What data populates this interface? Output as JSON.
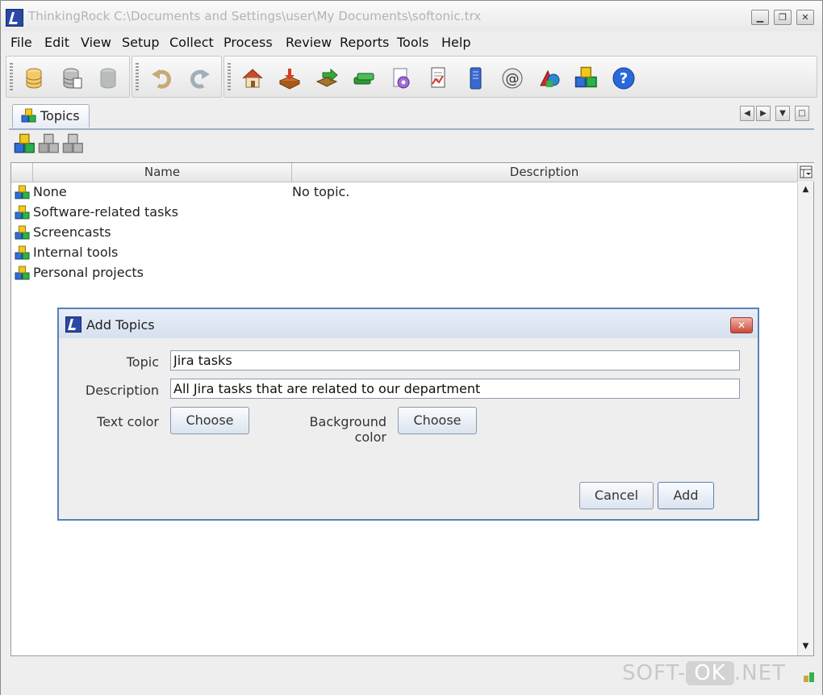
{
  "window": {
    "title": "ThinkingRock C:\\Documents and Settings\\user\\My Documents\\softonic.trx",
    "controls": [
      "minimize-icon",
      "restore-icon",
      "close-icon"
    ]
  },
  "menu": [
    "File",
    "Edit",
    "View",
    "Setup",
    "Collect",
    "Process",
    "Review",
    "Reports",
    "Tools",
    "Help"
  ],
  "tab": {
    "label": "Topics"
  },
  "table": {
    "columns": [
      "Name",
      "Description"
    ],
    "rows": [
      {
        "name": "None",
        "description": "No topic."
      },
      {
        "name": "Software-related tasks",
        "description": ""
      },
      {
        "name": "Screencasts",
        "description": ""
      },
      {
        "name": "Internal tools",
        "description": ""
      },
      {
        "name": "Personal projects",
        "description": ""
      }
    ]
  },
  "dialog": {
    "title": "Add Topics",
    "topic_label": "Topic",
    "topic_value": "Jira tasks",
    "description_label": "Description",
    "description_value": "All Jira tasks that are related to our department",
    "text_color_label": "Text color",
    "text_color_button": "Choose",
    "background_color_label": "Background color",
    "background_color_button": "Choose",
    "cancel_label": "Cancel",
    "add_label": "Add"
  },
  "watermark": {
    "left": "SOFT-",
    "middle": "OK",
    "right": ".NET"
  }
}
